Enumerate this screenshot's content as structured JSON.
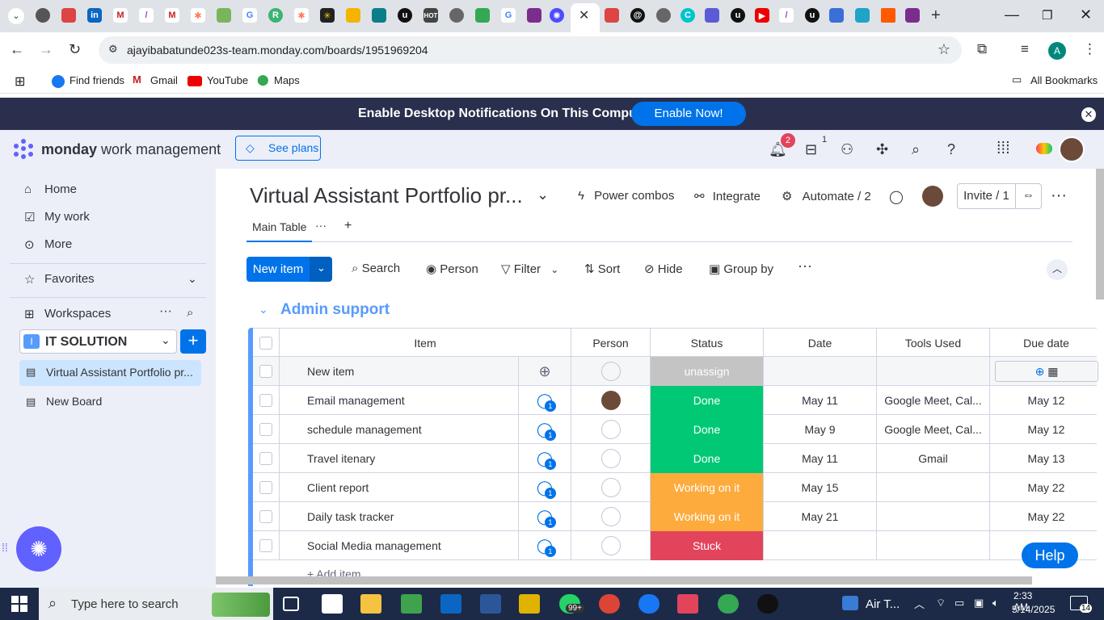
{
  "browser": {
    "url": "ajayibabatunde023s-team.monday.com/boards/1951969204",
    "bookmarks": [
      "Find friends",
      "Gmail",
      "YouTube",
      "Maps"
    ],
    "all_bookmarks": "All Bookmarks",
    "profile_initial": "A"
  },
  "banner": {
    "text": "Enable Desktop Notifications On This Computer",
    "button": "Enable Now!"
  },
  "header": {
    "brand": "monday",
    "product": "work management",
    "see_plans": "See plans",
    "notifications_count": "2",
    "inbox_count": "1"
  },
  "sidebar": {
    "home": "Home",
    "my_work": "My work",
    "more": "More",
    "favorites": "Favorites",
    "workspaces": "Workspaces",
    "workspace_initial": "I",
    "workspace_name": "IT SOLUTION",
    "boards": [
      "Virtual Assistant Portfolio pr...",
      "New Board"
    ]
  },
  "board": {
    "title": "Virtual Assistant Portfolio pr...",
    "power_combos": "Power combos",
    "integrate": "Integrate",
    "automate": "Automate / 2",
    "invite": "Invite / 1",
    "view_tab": "Main Table",
    "new_item": "New item",
    "search": "Search",
    "person": "Person",
    "filter": "Filter",
    "sort": "Sort",
    "hide": "Hide",
    "group_by": "Group by",
    "group_title": "Admin support",
    "add_item": "+ Add item"
  },
  "table": {
    "columns": [
      "Item",
      "Person",
      "Status",
      "Date",
      "Tools Used",
      "Due date"
    ],
    "rows": [
      {
        "item": "New item",
        "status": "unassign",
        "status_color": "#c4c4c4",
        "date": "",
        "tools": "",
        "due": ""
      },
      {
        "item": "Email management",
        "status": "Done",
        "status_color": "#00c875",
        "date": "May 11",
        "tools": "Google Meet, Cal...",
        "due": "May 12"
      },
      {
        "item": "schedule management",
        "status": "Done",
        "status_color": "#00c875",
        "date": "May 9",
        "tools": "Google Meet, Cal...",
        "due": "May 12"
      },
      {
        "item": "Travel itenary",
        "status": "Done",
        "status_color": "#00c875",
        "date": "May 11",
        "tools": "Gmail",
        "due": "May 13"
      },
      {
        "item": "Client report",
        "status": "Working on it",
        "status_color": "#fdab3d",
        "date": "May 15",
        "tools": "",
        "due": "May 22"
      },
      {
        "item": "Daily task tracker",
        "status": "Working on it",
        "status_color": "#fdab3d",
        "date": "May 21",
        "tools": "",
        "due": "May 22"
      },
      {
        "item": "Social Media management",
        "status": "Stuck",
        "status_color": "#e2445c",
        "date": "",
        "tools": "",
        "due": ""
      }
    ],
    "update_count": "1"
  },
  "help": "Help",
  "taskbar": {
    "search_placeholder": "Type here to search",
    "weather": "Air T...",
    "time": "2:33 AM",
    "date": "5/14/2025",
    "notif_count": "14",
    "whatsapp_badge": "99+"
  }
}
